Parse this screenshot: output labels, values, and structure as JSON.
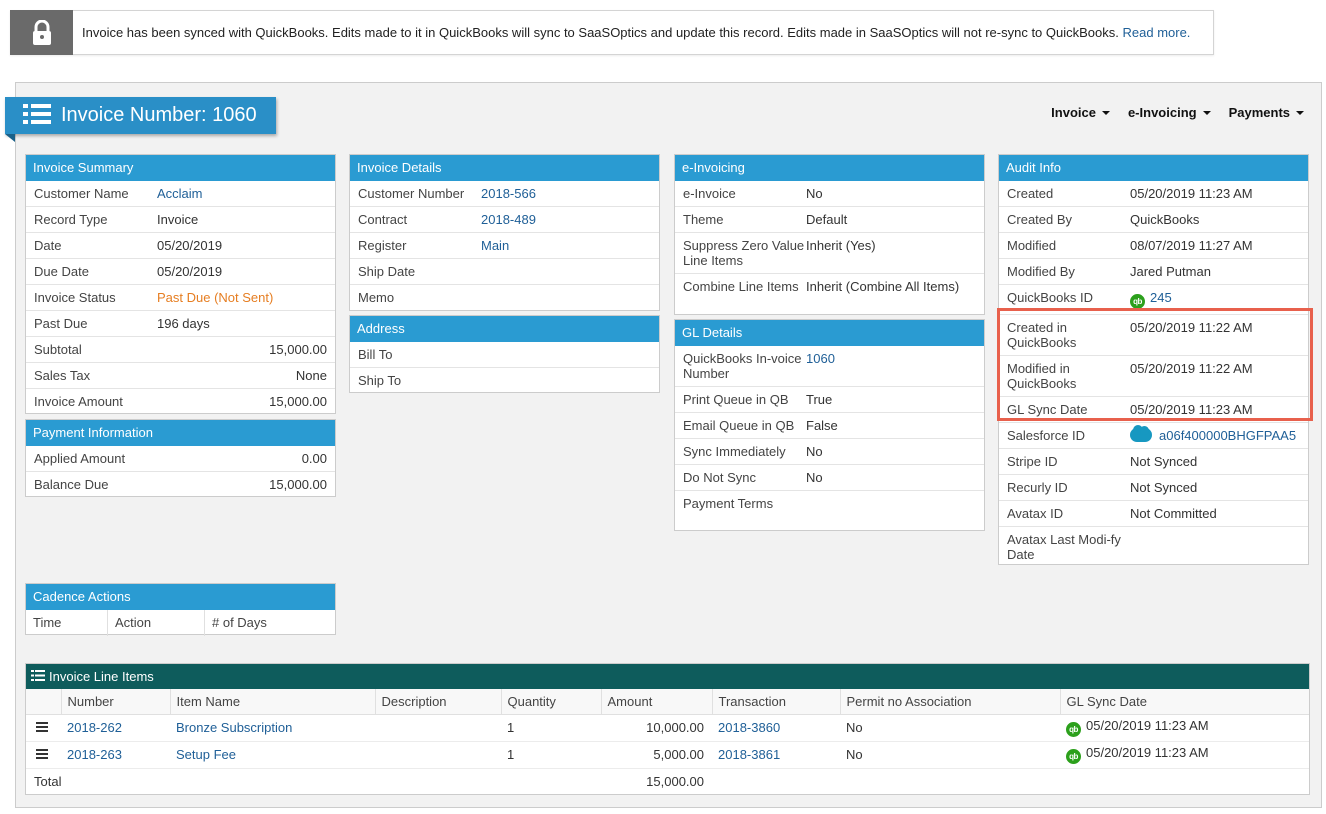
{
  "notice": {
    "message": "Invoice has been synced with QuickBooks. Edits made to it in QuickBooks will sync to SaaSOptics and update this record. Edits made in SaaSOptics will not re-sync to QuickBooks.",
    "link": "Read more."
  },
  "page": {
    "title": "Invoice Number: 1060",
    "nav": [
      "Invoice",
      "e-Invoicing",
      "Payments"
    ]
  },
  "invoice_summary": {
    "header": "Invoice Summary",
    "rows": [
      {
        "label": "Customer Name",
        "value": "Acclaim"
      },
      {
        "label": "Record Type",
        "value": "Invoice"
      },
      {
        "label": "Date",
        "value": "05/20/2019"
      },
      {
        "label": "Due Date",
        "value": "05/20/2019"
      },
      {
        "label": "Invoice Status",
        "value": "Past Due (Not Sent)"
      },
      {
        "label": "Past Due",
        "value": "196 days"
      },
      {
        "label": "Subtotal",
        "value": "15,000.00"
      },
      {
        "label": "Sales Tax",
        "value": "None"
      },
      {
        "label": "Invoice Amount",
        "value": "15,000.00"
      }
    ]
  },
  "payment_info": {
    "header": "Payment Information",
    "rows": [
      {
        "label": "Applied Amount",
        "value": "0.00"
      },
      {
        "label": "Balance Due",
        "value": "15,000.00"
      }
    ]
  },
  "invoice_details": {
    "header": "Invoice Details",
    "rows": [
      {
        "label": "Customer Number",
        "value": "2018-566"
      },
      {
        "label": "Contract",
        "value": "2018-489"
      },
      {
        "label": "Register",
        "value": "Main"
      },
      {
        "label": "Ship Date",
        "value": ""
      },
      {
        "label": "Memo",
        "value": ""
      }
    ]
  },
  "address": {
    "header": "Address",
    "rows": [
      {
        "label": "Bill To",
        "value": ""
      },
      {
        "label": "Ship To",
        "value": ""
      }
    ]
  },
  "einvoicing": {
    "header": "e-Invoicing",
    "rows": [
      {
        "label": "e-Invoice",
        "value": "No"
      },
      {
        "label": "Theme",
        "value": "Default"
      },
      {
        "label": "Suppress Zero Value Line Items",
        "value": "Inherit (Yes)"
      },
      {
        "label": "Combine Line Items",
        "value": "Inherit (Combine All Items)"
      }
    ]
  },
  "gl_details": {
    "header": "GL Details",
    "rows": [
      {
        "label": "QuickBooks In-voice Number",
        "value": "1060"
      },
      {
        "label": "Print Queue in QB",
        "value": "True"
      },
      {
        "label": "Email Queue in QB",
        "value": "False"
      },
      {
        "label": "Sync Immediately",
        "value": "No"
      },
      {
        "label": "Do Not Sync",
        "value": "No"
      },
      {
        "label": "Payment Terms",
        "value": ""
      }
    ]
  },
  "audit_info": {
    "header": "Audit Info",
    "rows": [
      {
        "label": "Created",
        "value": "05/20/2019 11:23 AM"
      },
      {
        "label": "Created By",
        "value": "QuickBooks"
      },
      {
        "label": "Modified",
        "value": "08/07/2019 11:27 AM"
      },
      {
        "label": "Modified By",
        "value": "Jared Putman"
      },
      {
        "label": "QuickBooks ID",
        "value": "245"
      },
      {
        "label": "Created in QuickBooks",
        "value": "05/20/2019 11:22 AM"
      },
      {
        "label": "Modified in QuickBooks",
        "value": "05/20/2019 11:22 AM"
      },
      {
        "label": "GL Sync Date",
        "value": "05/20/2019 11:23 AM"
      },
      {
        "label": "Salesforce ID",
        "value": "a06f400000BHGFPAA5"
      },
      {
        "label": "Stripe ID",
        "value": "Not Synced"
      },
      {
        "label": "Recurly ID",
        "value": "Not Synced"
      },
      {
        "label": "Avatax ID",
        "value": "Not Committed"
      },
      {
        "label": "Avatax Last Modi-fy Date",
        "value": ""
      }
    ]
  },
  "cadence": {
    "header": "Cadence Actions",
    "columns": [
      "Time",
      "Action",
      "# of Days"
    ]
  },
  "line_items": {
    "header": "Invoice Line Items",
    "columns": [
      "Number",
      "Item Name",
      "Description",
      "Quantity",
      "Amount",
      "Transaction",
      "Permit no Association",
      "GL Sync Date"
    ],
    "rows": [
      {
        "number": "2018-262",
        "item": "Bronze Subscription",
        "description": "",
        "quantity": "1",
        "amount": "10,000.00",
        "transaction": "2018-3860",
        "permit": "No",
        "gl_sync": "05/20/2019 11:23 AM"
      },
      {
        "number": "2018-263",
        "item": "Setup Fee",
        "description": "",
        "quantity": "1",
        "amount": "5,000.00",
        "transaction": "2018-3861",
        "permit": "No",
        "gl_sync": "05/20/2019 11:23 AM"
      }
    ],
    "total_label": "Total",
    "total_amount": "15,000.00"
  },
  "icons": {
    "lock": "lock-icon",
    "list": "list-icon",
    "quickbooks": "qb-icon",
    "salesforce": "salesforce-icon"
  },
  "colors": {
    "header_blue": "#2a9bd2",
    "line_items_header": "#0e5c5c",
    "highlight": "#e8604c",
    "link": "#1f5f97",
    "status_orange": "#e67e22"
  }
}
